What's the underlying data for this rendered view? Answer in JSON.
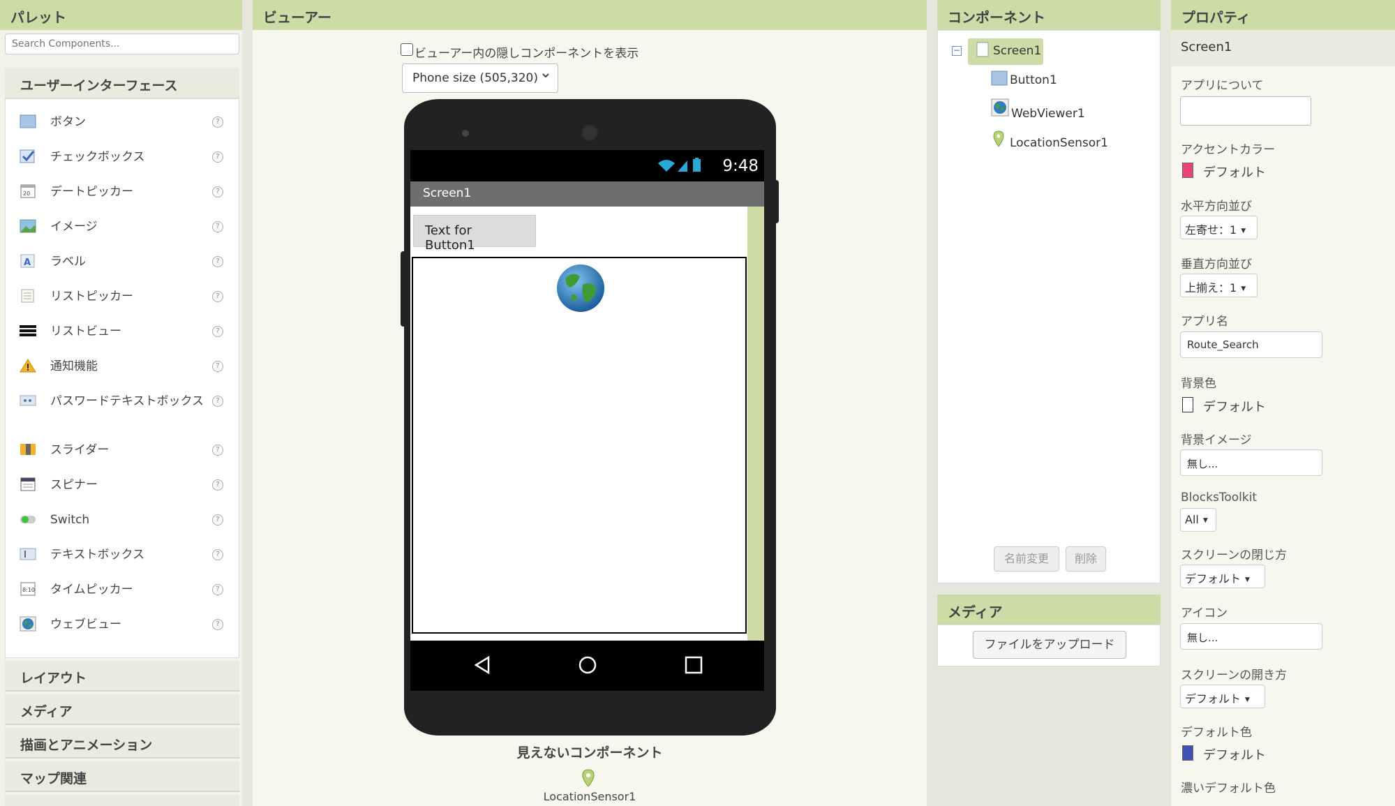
{
  "palette": {
    "title": "パレット",
    "search_placeholder": "Search Components...",
    "ui_section": "ユーザーインターフェース",
    "items": [
      {
        "label": "ボタン",
        "icon": "button-icon"
      },
      {
        "label": "チェックボックス",
        "icon": "checkbox-icon"
      },
      {
        "label": "デートピッカー",
        "icon": "datepicker-icon"
      },
      {
        "label": "イメージ",
        "icon": "image-icon"
      },
      {
        "label": "ラベル",
        "icon": "label-icon"
      },
      {
        "label": "リストピッカー",
        "icon": "listpicker-icon"
      },
      {
        "label": "リストビュー",
        "icon": "listview-icon"
      },
      {
        "label": "通知機能",
        "icon": "notifier-icon"
      },
      {
        "label": "パスワードテキストボックス",
        "icon": "password-icon"
      },
      {
        "label": "スライダー",
        "icon": "slider-icon"
      },
      {
        "label": "スピナー",
        "icon": "spinner-icon"
      },
      {
        "label": "Switch",
        "icon": "switch-icon"
      },
      {
        "label": "テキストボックス",
        "icon": "textbox-icon"
      },
      {
        "label": "タイムピッカー",
        "icon": "timepicker-icon"
      },
      {
        "label": "ウェブビュー",
        "icon": "webviewer-icon"
      }
    ],
    "help_glyph": "?",
    "sections": [
      "レイアウト",
      "メディア",
      "描画とアニメーション",
      "マップ関連"
    ]
  },
  "viewer": {
    "title": "ビューアー",
    "hidden_checkbox_label": "ビューアー内の隠しコンポーネントを表示",
    "hidden_checked": false,
    "phone_size": "Phone size (505,320)",
    "clock": "9:48",
    "screen_title": "Screen1",
    "button_text": "Text for Button1",
    "invisible_title": "見えないコンポーネント",
    "invisible_component": "LocationSensor1"
  },
  "components": {
    "title": "コンポーネント",
    "tree": [
      {
        "name": "Screen1",
        "level": 0,
        "selected": true
      },
      {
        "name": "Button1",
        "level": 1
      },
      {
        "name": "WebViewer1",
        "level": 1
      },
      {
        "name": "LocationSensor1",
        "level": 1
      }
    ],
    "rename": "名前変更",
    "delete": "削除"
  },
  "media": {
    "title": "メディア",
    "upload": "ファイルをアップロード"
  },
  "properties": {
    "title": "プロパティ",
    "component": "Screen1",
    "about_label": "アプリについて",
    "accent_label": "アクセントカラー",
    "accent_value": "デフォルト",
    "accent_color": "#e8457a",
    "halign_label": "水平方向並び",
    "halign_value": "左寄せ：1",
    "valign_label": "垂直方向並び",
    "valign_value": "上揃え：1",
    "appname_label": "アプリ名",
    "appname_value": "Route_Search",
    "bgcolor_label": "背景色",
    "bgcolor_value": "デフォルト",
    "bgcolor_color": "#ffffff",
    "bgimage_label": "背景イメージ",
    "bgimage_value": "無し...",
    "blocks_label": "BlocksToolkit",
    "blocks_value": "All",
    "close_anim_label": "スクリーンの閉じ方",
    "close_anim_value": "デフォルト",
    "icon_label": "アイコン",
    "icon_value": "無し...",
    "open_anim_label": "スクリーンの開き方",
    "open_anim_value": "デフォルト",
    "primary_label": "デフォルト色",
    "primary_value": "デフォルト",
    "primary_color": "#3f51b5",
    "primary_dark_label": "濃いデフォルト色"
  }
}
